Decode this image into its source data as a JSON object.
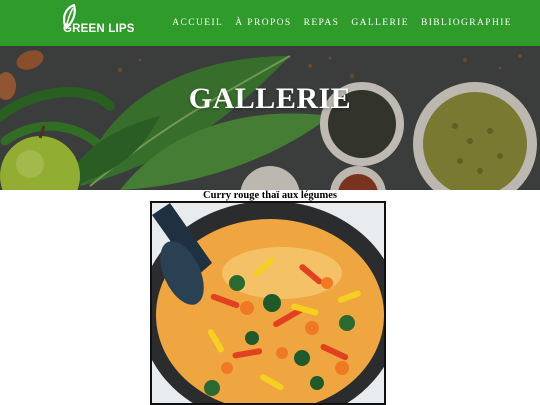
{
  "brand": {
    "logo_text": "GREEN LIPS"
  },
  "nav": {
    "items": [
      {
        "label": "ACCUEIL"
      },
      {
        "label": "À PROPOS"
      },
      {
        "label": "REPAS"
      },
      {
        "label": "GALLERIE"
      },
      {
        "label": "BIBLIOGRAPHIE"
      }
    ]
  },
  "hero": {
    "title": "GALLERIE"
  },
  "gallery": {
    "items": [
      {
        "caption": "Curry rouge thaï aux légumes"
      }
    ]
  },
  "colors": {
    "nav_background": "#2e9b2a",
    "nav_text": "#ffffff",
    "hero_text": "#ffffff"
  },
  "icons": {
    "logo": "leaf-icon"
  }
}
